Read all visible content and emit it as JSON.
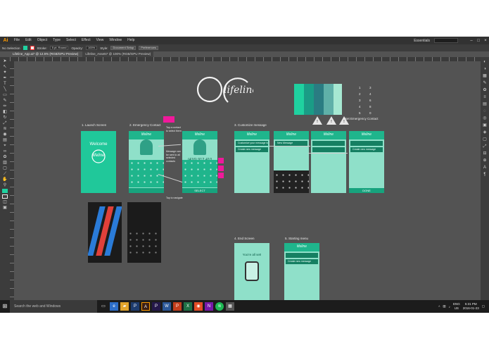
{
  "app": {
    "logo": "Ai"
  },
  "menu": [
    "File",
    "Edit",
    "Object",
    "Type",
    "Select",
    "Effect",
    "View",
    "Window",
    "Help"
  ],
  "workspace": "Essentials",
  "control_bar": {
    "selection": "No Selection",
    "stroke_label": "Stroke:",
    "brush": "5 pt. Round",
    "opacity_label": "Opacity:",
    "opacity": "100%",
    "style_label": "Style:",
    "doc_setup": "Document Setup",
    "preferences": "Preferences"
  },
  "tabs": [
    "Lifeline_App.ai* @ 12.5% (RGB/GPU Preview)",
    "Lifeline_Assets* @ 100% (RGB/GPU Preview)"
  ],
  "status": {
    "zoom": "12.5%",
    "artboard": "1",
    "tool": "Selection"
  },
  "brand": {
    "name": "lifeline"
  },
  "palette": {
    "colors": [
      "#1fd1a0",
      "#1a9c86",
      "#2a7c82",
      "#5fb0a8",
      "#a6e8d2"
    ],
    "numbers_left": [
      "1",
      "2",
      "3",
      "4",
      "5"
    ],
    "numbers_right": [
      "3",
      "4",
      "6",
      "8",
      "0"
    ],
    "caption": "Set Emergency Contact"
  },
  "sections": {
    "launch": "1. Launch Screen",
    "emergency": "2. Emergency Contact",
    "customize": "3. Customize message",
    "end": "4. End Screen",
    "starting": "5. Starting menu"
  },
  "screens": {
    "welcome": "Welcome",
    "logo": "lifeline",
    "phone_number": "(416) 912 410",
    "select": "SELECT",
    "done": "DONE",
    "end_title": "You're all set!",
    "create_message": "Create new message",
    "custom_header": "Customize your message to be sent to contacts",
    "new_message": "New Message",
    "note_1": "Tap a contact to select them",
    "note_2": "Message can be sent to all selected contacts",
    "note_3": "Tap to navigate"
  },
  "taskbar": {
    "search": "Search the web and Windows",
    "lang": "ENG",
    "region": "US",
    "time": "5:31 PM",
    "date": "2016-01-23"
  },
  "accent": "#20c89a",
  "highlight": "#f0199b"
}
